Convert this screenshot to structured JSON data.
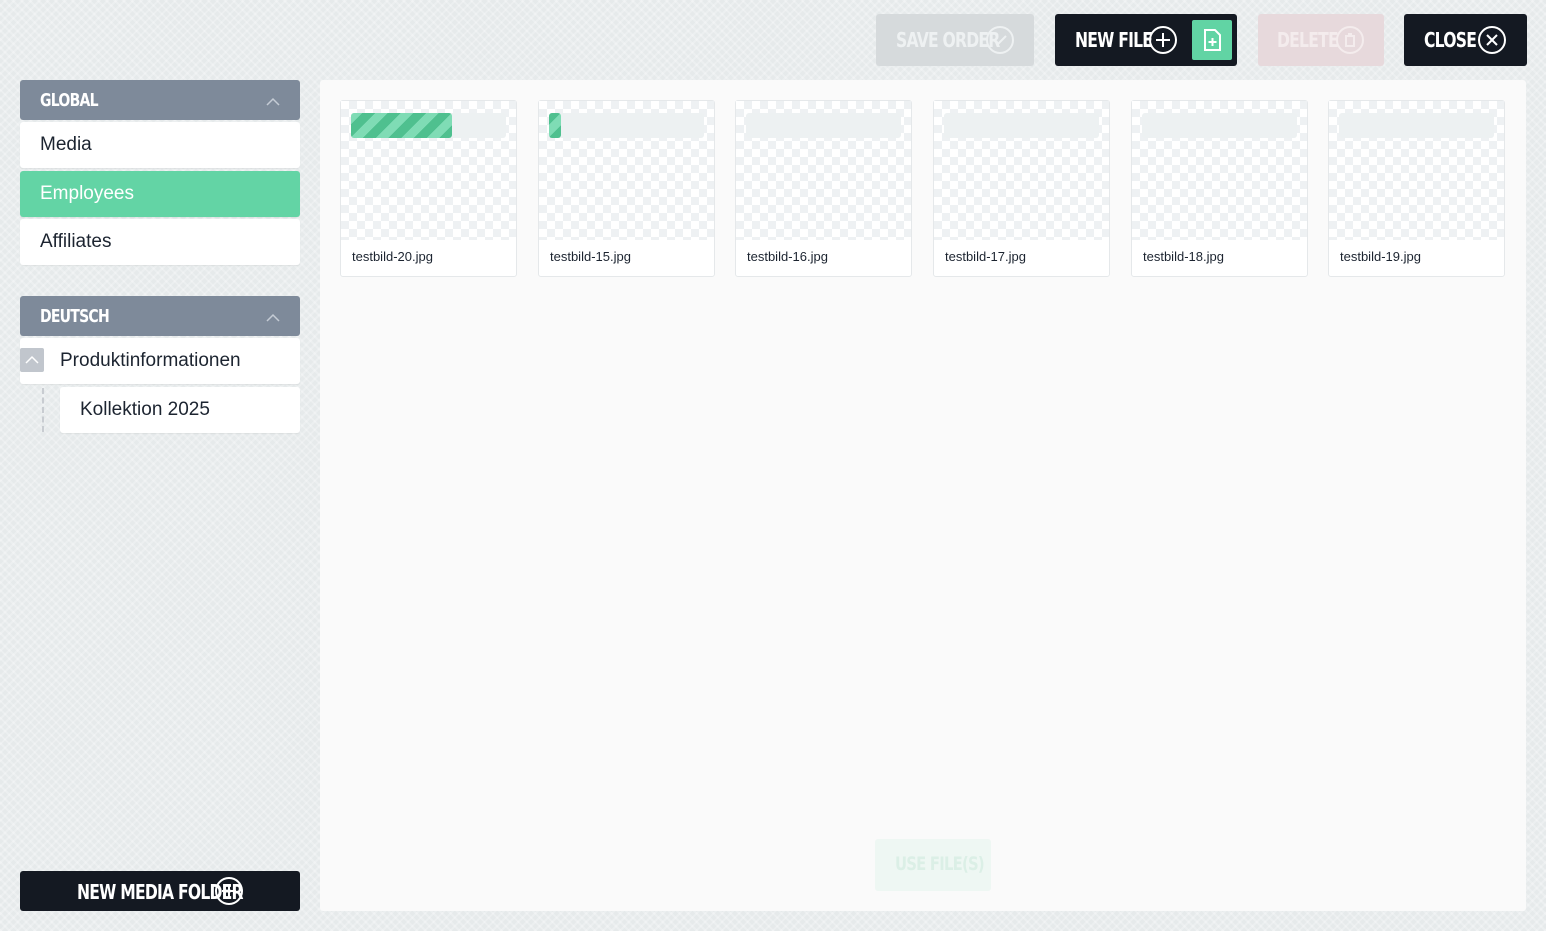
{
  "toolbar": {
    "save_order": "Save Order",
    "new_file": "New File",
    "delete": "Delete",
    "close": "Close"
  },
  "sidebar": {
    "groups": [
      {
        "title": "Global",
        "items": [
          {
            "label": "Media"
          },
          {
            "label": "Employees",
            "active": true
          },
          {
            "label": "Affiliates"
          }
        ]
      },
      {
        "title": "Deutsch",
        "items": [
          {
            "label": "Produktinformationen"
          },
          {
            "label": "Kollektion 2025"
          }
        ]
      }
    ],
    "new_folder": "New Media Folder"
  },
  "files": [
    {
      "name": "testbild-20.jpg",
      "upload_progress": 0.65
    },
    {
      "name": "testbild-15.jpg",
      "upload_progress": 0.08
    },
    {
      "name": "testbild-16.jpg",
      "upload_progress": 0
    },
    {
      "name": "testbild-17.jpg",
      "upload_progress": 0
    },
    {
      "name": "testbild-18.jpg",
      "upload_progress": 0
    },
    {
      "name": "testbild-19.jpg",
      "upload_progress": 0
    }
  ],
  "footer": {
    "use_files": "Use File(s)"
  },
  "colors": {
    "accent": "#63d4a5",
    "dark": "#141922",
    "header": "#7e8a9a"
  }
}
